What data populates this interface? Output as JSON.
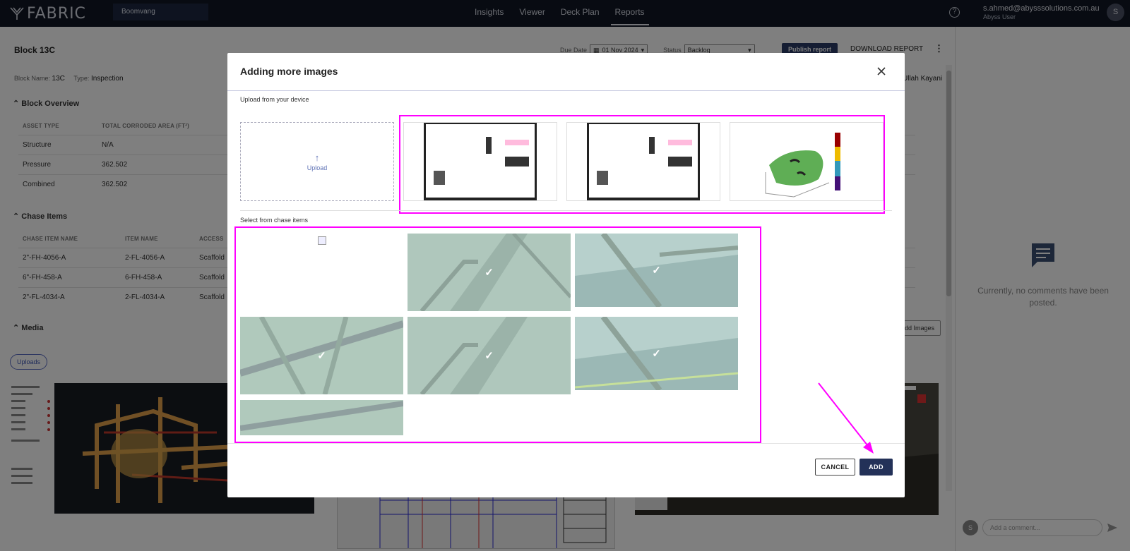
{
  "topbar": {
    "logo": "FABRIC",
    "project": "Boomvang",
    "nav": [
      "Insights",
      "Viewer",
      "Deck Plan",
      "Reports"
    ],
    "active_nav": "Reports",
    "user_email": "s.ahmed@abysssolutions.com.au",
    "user_role": "Abyss User",
    "avatar": "S"
  },
  "report": {
    "title": "Block 13C",
    "due_label": "Due Date",
    "due_value": "01 Nov 2024",
    "status_label": "Status",
    "status_value": "Backlog",
    "publish": "Publish report",
    "download": "DOWNLOAD REPORT",
    "block_name_label": "Block Name:",
    "block_name": "13C",
    "type_label": "Type:",
    "type": "Inspection",
    "owner": "Ullah Kayani"
  },
  "overview": {
    "heading": "Block Overview",
    "cols": [
      "ASSET TYPE",
      "TOTAL CORRODED AREA (FT²)"
    ],
    "rows": [
      [
        "Structure",
        "N/A"
      ],
      [
        "Pressure",
        "362.502"
      ],
      [
        "Combined",
        "362.502"
      ]
    ]
  },
  "chase": {
    "heading": "Chase Items",
    "cols": [
      "CHASE ITEM NAME",
      "ITEM NAME",
      "ACCESS"
    ],
    "rows": [
      [
        "2\"-FH-4056-A",
        "2-FL-4056-A",
        "Scaffold"
      ],
      [
        "6\"-FH-458-A",
        "6-FH-458-A",
        "Scaffold"
      ],
      [
        "2\"-FL-4034-A",
        "2-FL-4034-A",
        "Scaffold"
      ]
    ]
  },
  "media": {
    "heading": "Media",
    "uploads_chip": "Uploads",
    "add_images": "Add Images"
  },
  "comments": {
    "empty": "Currently, no comments have been posted.",
    "placeholder": "Add a comment...",
    "avatar": "S"
  },
  "modal": {
    "title": "Adding more images",
    "upload_section": "Upload from your device",
    "upload_label": "Upload",
    "chase_section": "Select from chase items",
    "cancel": "CANCEL",
    "add": "ADD"
  },
  "colors": {
    "highlight": "#ff00ff",
    "primary": "#233158",
    "topbar": "#101625"
  }
}
